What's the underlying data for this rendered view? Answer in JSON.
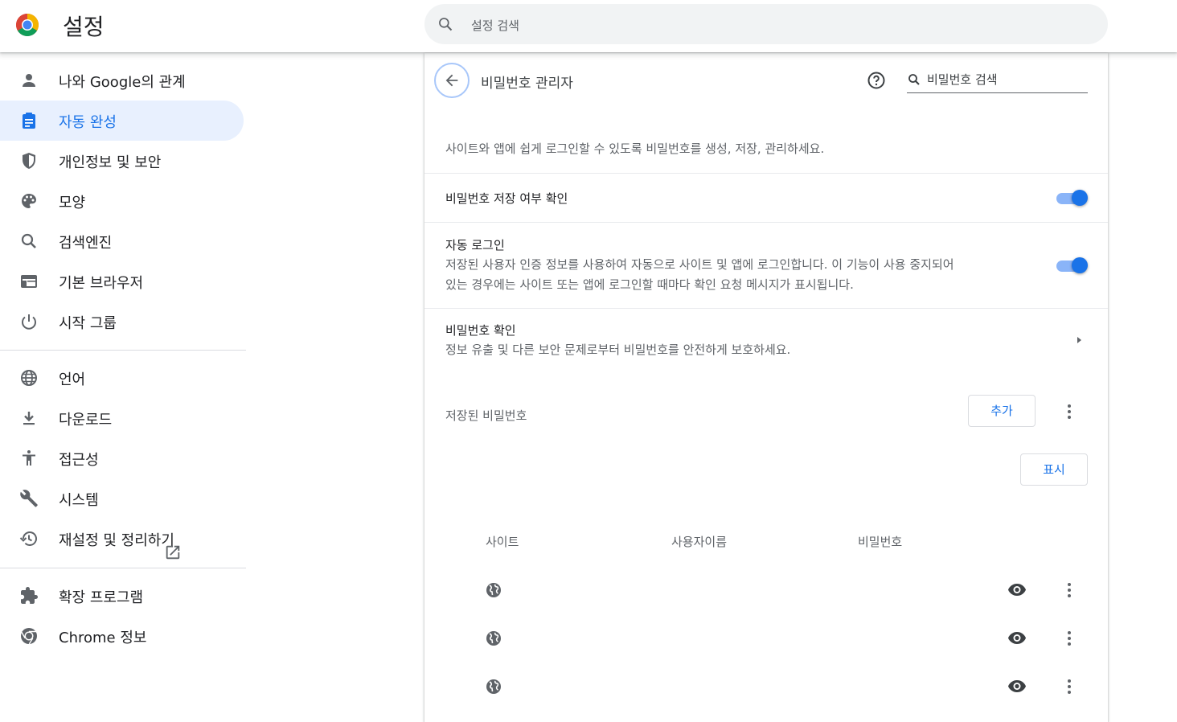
{
  "header": {
    "title": "설정",
    "search_placeholder": "설정 검색",
    "logo_icon": "chrome-logo-icon",
    "search_icon": "search-icon"
  },
  "sidebar": {
    "items": [
      {
        "label": "나와 Google의 관계",
        "icon": "person-icon"
      },
      {
        "label": "자동 완성",
        "icon": "clipboard-icon",
        "selected": true
      },
      {
        "label": "개인정보 및 보안",
        "icon": "shield-icon"
      },
      {
        "label": "모양",
        "icon": "palette-icon"
      },
      {
        "label": "검색엔진",
        "icon": "search-icon"
      },
      {
        "label": "기본 브라우저",
        "icon": "browser-icon"
      },
      {
        "label": "시작 그룹",
        "icon": "power-icon"
      },
      {
        "label": "언어",
        "icon": "globe-icon"
      },
      {
        "label": "다운로드",
        "icon": "download-icon"
      },
      {
        "label": "접근성",
        "icon": "accessibility-icon"
      },
      {
        "label": "시스템",
        "icon": "wrench-icon"
      },
      {
        "label": "재설정 및 정리하기",
        "icon": "history-icon"
      },
      {
        "label": "확장 프로그램",
        "icon": "puzzle-icon"
      },
      {
        "label": "Chrome 정보",
        "icon": "chrome-icon"
      }
    ]
  },
  "main": {
    "title": "비밀번호 관리자",
    "search_placeholder": "비밀번호 검색",
    "description": "사이트와 앱에 쉽게 로그인할 수 있도록 비밀번호를 생성, 저장, 관리하세요.",
    "offer_to_save": {
      "label": "비밀번호 저장 여부 확인",
      "enabled": true
    },
    "auto_signin": {
      "label": "자동 로그인",
      "description_line1": "저장된 사용자 인증 정보를 사용하여 자동으로 사이트 및 앱에 로그인합니다. 이 기능이 사용 중지되어",
      "description_line2": "있는 경우에는 사이트 또는 앱에 로그인할 때마다 확인 요청 메시지가 표시됩니다.",
      "enabled": true
    },
    "check_passwords": {
      "label": "비밀번호 확인",
      "description": "정보 유출 및 다른 보안 문제로부터 비밀번호를 안전하게 보호하세요."
    },
    "saved_passwords": {
      "label": "저장된 비밀번호",
      "add_button": "추가",
      "show_button": "표시",
      "columns": [
        "사이트",
        "사용자이름",
        "비밀번호"
      ],
      "rows": [
        {
          "site": "",
          "username": "",
          "password": ""
        },
        {
          "site": "",
          "username": "",
          "password": ""
        },
        {
          "site": "",
          "username": "",
          "password": ""
        }
      ]
    }
  },
  "colors": {
    "accent": "#1a73e8",
    "selected_bg": "#e8f0fe",
    "toggle_track": "#8ab4f8"
  }
}
